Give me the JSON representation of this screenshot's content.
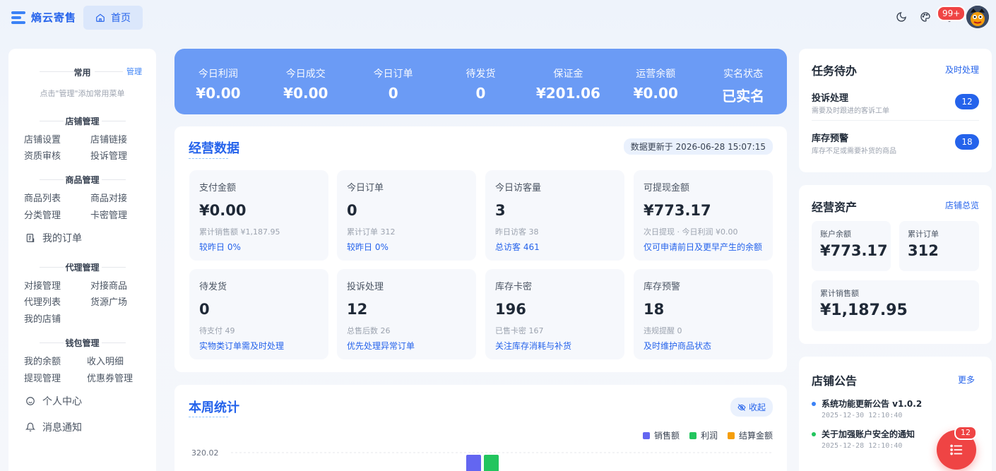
{
  "header": {
    "brand": "熵云寄售",
    "home_tab": "首页",
    "notification_count": "99+"
  },
  "sidebar": {
    "favorites_title": "常用",
    "manage_link": "管理",
    "favorites_hint": "点击\"管理\"添加常用菜单",
    "shop": {
      "title": "店铺管理",
      "items": [
        "店铺设置",
        "店铺链接",
        "资质审核",
        "投诉管理"
      ]
    },
    "goods": {
      "title": "商品管理",
      "items": [
        "商品列表",
        "商品对接",
        "分类管理",
        "卡密管理"
      ]
    },
    "my_orders": "我的订单",
    "agent": {
      "title": "代理管理",
      "items": [
        "对接管理",
        "对接商品",
        "代理列表",
        "货源广场",
        "我的店铺"
      ]
    },
    "wallet": {
      "title": "钱包管理",
      "items": [
        "我的余额",
        "收入明细",
        "提现管理",
        "优惠券管理"
      ]
    },
    "profile": "个人中心",
    "messages": "消息通知"
  },
  "banner": [
    {
      "label": "今日利润",
      "value": "¥0.00"
    },
    {
      "label": "今日成交",
      "value": "¥0.00"
    },
    {
      "label": "今日订单",
      "value": "0"
    },
    {
      "label": "待发货",
      "value": "0"
    },
    {
      "label": "保证金",
      "value": "¥201.06"
    },
    {
      "label": "运营余额",
      "value": "¥0.00"
    },
    {
      "label": "实名状态",
      "value": "已实名"
    }
  ],
  "business": {
    "title": "经营数据",
    "updated": "数据更新于 2026-06-28 15:07:15",
    "tiles": [
      {
        "label": "支付金额",
        "value": "¥0.00",
        "sub": "累计销售额 ¥1,187.95",
        "note": "较昨日 0%"
      },
      {
        "label": "今日订单",
        "value": "0",
        "sub": "累计订单 312",
        "note": "较昨日 0%"
      },
      {
        "label": "今日访客量",
        "value": "3",
        "sub": "昨日访客 38",
        "note": "总访客 461"
      },
      {
        "label": "可提现金额",
        "value": "¥773.17",
        "sub": "次日提现 · 今日利润 ¥0.00",
        "note": "仅可申请前日及更早产生的余额"
      },
      {
        "label": "待发货",
        "value": "0",
        "sub": "待支付 49",
        "note": "实物类订单需及时处理"
      },
      {
        "label": "投诉处理",
        "value": "12",
        "sub": "总售后数 26",
        "note": "优先处理异常订单"
      },
      {
        "label": "库存卡密",
        "value": "196",
        "sub": "已售卡密 167",
        "note": "关注库存消耗与补货"
      },
      {
        "label": "库存预警",
        "value": "18",
        "sub": "违规提醒 0",
        "note": "及时维护商品状态"
      }
    ]
  },
  "weekly": {
    "title": "本周统计",
    "collapse": "收起"
  },
  "chart_data": {
    "type": "bar",
    "series": [
      {
        "name": "销售额",
        "color": "#6366f1"
      },
      {
        "name": "利润",
        "color": "#22c55e"
      },
      {
        "name": "结算金额",
        "color": "#f59e0b"
      }
    ],
    "y_top_tick": "320.02"
  },
  "todo": {
    "title": "任务待办",
    "link": "及时处理",
    "items": [
      {
        "name": "投诉处理",
        "desc": "需要及时跟进的客诉工单",
        "count": "12"
      },
      {
        "name": "库存预警",
        "desc": "库存不足或需要补货的商品",
        "count": "18"
      }
    ]
  },
  "assets": {
    "title": "经营资产",
    "link": "店铺总览",
    "balance_label": "账户余额",
    "balance": "¥773.17",
    "orders_label": "累计订单",
    "orders": "312",
    "sales_label": "累计销售额",
    "sales": "¥1,187.95"
  },
  "notices": {
    "title": "店铺公告",
    "more": "更多",
    "items": [
      {
        "title": "系统功能更新公告 v1.0.2",
        "date": "2025-12-30 12:10:40",
        "color": "#3b82f6"
      },
      {
        "title": "关于加强账户安全的通知",
        "date": "2025-12-28 12:10:40",
        "color": "#22c55e"
      }
    ]
  },
  "fab_badge": "12"
}
